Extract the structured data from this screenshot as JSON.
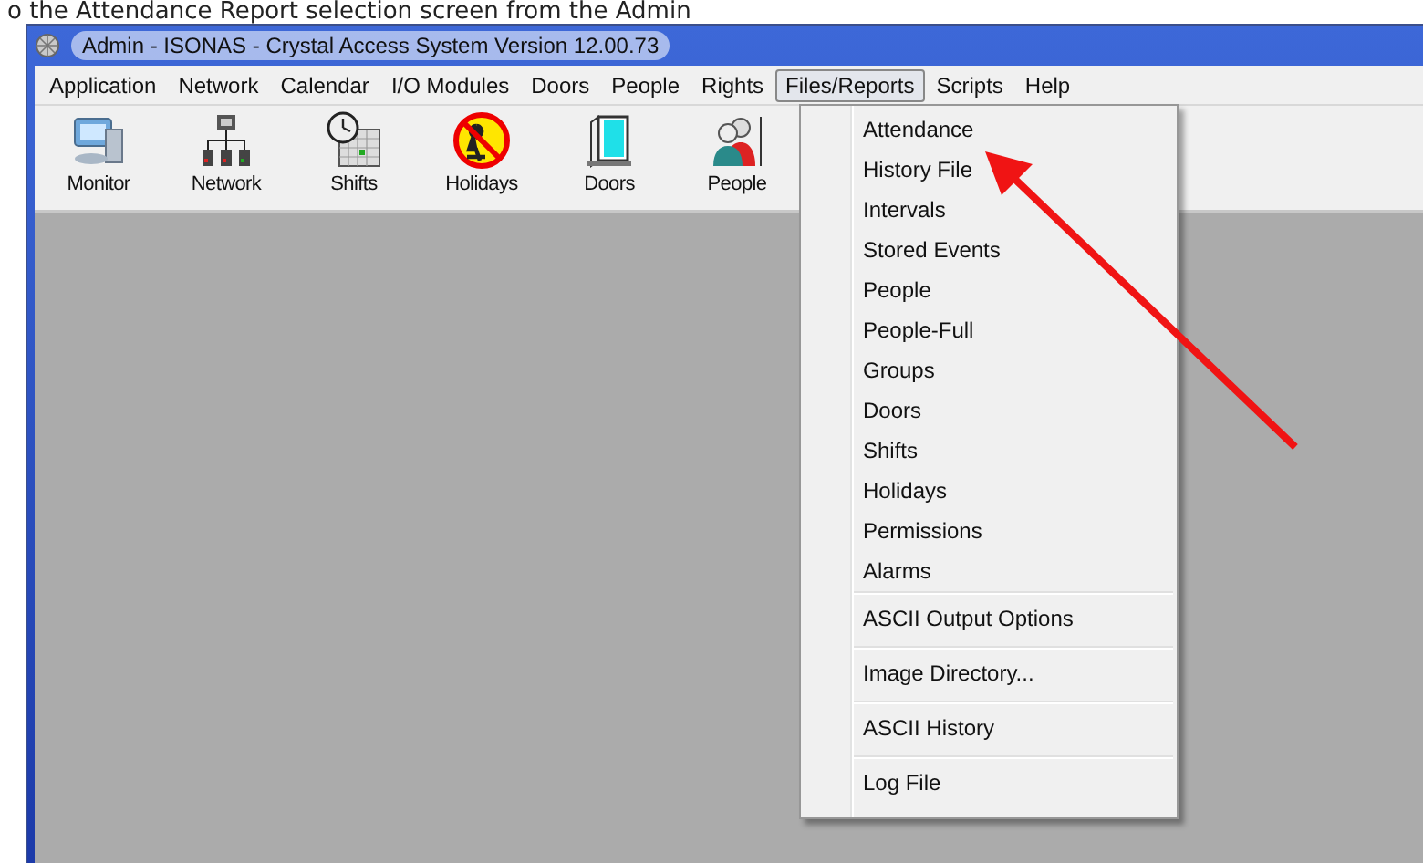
{
  "caption": "o the Attendance Report selection screen from the Admin",
  "window": {
    "title": "Admin - ISONAS - Crystal Access System Version 12.00.73"
  },
  "menu_bar": [
    {
      "label": "Application",
      "selected": false
    },
    {
      "label": "Network",
      "selected": false
    },
    {
      "label": "Calendar",
      "selected": false
    },
    {
      "label": "I/O Modules",
      "selected": false
    },
    {
      "label": "Doors",
      "selected": false
    },
    {
      "label": "People",
      "selected": false
    },
    {
      "label": "Rights",
      "selected": false
    },
    {
      "label": "Files/Reports",
      "selected": true
    },
    {
      "label": "Scripts",
      "selected": false
    },
    {
      "label": "Help",
      "selected": false
    }
  ],
  "toolbar": [
    {
      "label": "Monitor",
      "kind": "monitor"
    },
    {
      "label": "Network",
      "kind": "network"
    },
    {
      "label": "Shifts",
      "kind": "shifts"
    },
    {
      "label": "Holidays",
      "kind": "holidays"
    },
    {
      "label": "Doors",
      "kind": "doors"
    },
    {
      "label": "People",
      "kind": "people"
    }
  ],
  "dropdown": {
    "groups": [
      [
        "Attendance",
        "History File",
        "Intervals",
        "Stored Events",
        "People",
        "People-Full",
        "Groups",
        "Doors",
        "Shifts",
        "Holidays",
        "Permissions",
        "Alarms"
      ],
      [
        "ASCII Output Options"
      ],
      [
        "Image Directory..."
      ],
      [
        "ASCII History"
      ],
      [
        "Log File"
      ]
    ]
  }
}
